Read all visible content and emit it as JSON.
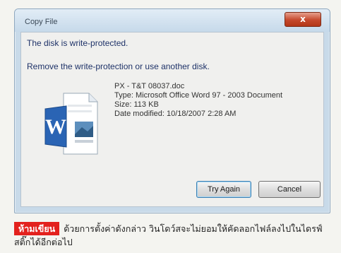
{
  "dialog": {
    "title": "Copy File",
    "close_label": "x",
    "message": "The disk is write-protected.",
    "instruction": "Remove the write-protection or use another disk.",
    "file": {
      "name": "PX - T&T 08037.doc",
      "type": "Type: Microsoft Office Word 97 - 2003 Document",
      "size": "Size: 113 KB",
      "date_modified": "Date modified: 10/18/2007 2:28 AM"
    },
    "buttons": {
      "try_again": "Try Again",
      "cancel": "Cancel"
    }
  },
  "caption": {
    "badge": "ห้ามเขียน",
    "text": "ด้วยการตั้งค่าดังกล่าว วินโดว์สจะไม่ยอมให้คัดลอกไฟล์ลงไปในไดรฟ์สติ๊กได้อีกต่อไป"
  },
  "colors": {
    "badge_bg": "#e3211d",
    "close_button": "#c5482c",
    "message_text": "#1e3268"
  }
}
